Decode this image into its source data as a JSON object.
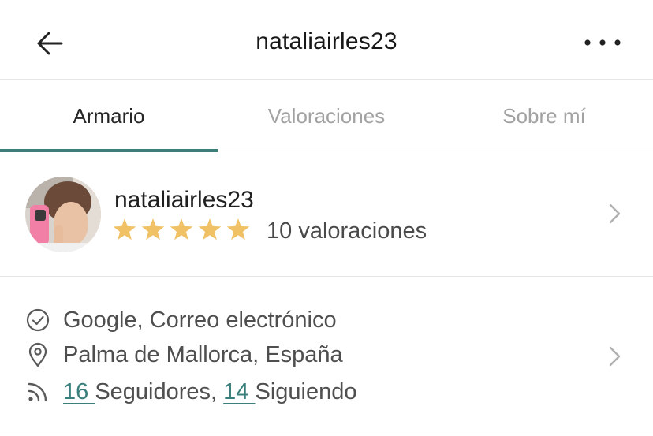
{
  "header": {
    "title": "nataliairles23",
    "back_icon": "arrow-left-icon",
    "more_icon": "more-horizontal-icon"
  },
  "tabs": [
    {
      "label": "Armario",
      "active": true
    },
    {
      "label": "Valoraciones",
      "active": false
    },
    {
      "label": "Sobre mí",
      "active": false
    }
  ],
  "profile": {
    "username": "nataliairles23",
    "rating": 5,
    "rating_max": 5,
    "ratings_text": "10 valoraciones",
    "star_color": "#f0c265"
  },
  "info": {
    "verified_text": "Google, Correo electrónico",
    "location": "Palma de Mallorca, España",
    "followers_count": "16 ",
    "followers_label": "Seguidores,",
    "following_count": "14 ",
    "following_label": "Siguiendo"
  },
  "colors": {
    "accent": "#3a7f7b",
    "divider": "#e6e6e6",
    "inactive_tab": "#a2a2a2"
  }
}
